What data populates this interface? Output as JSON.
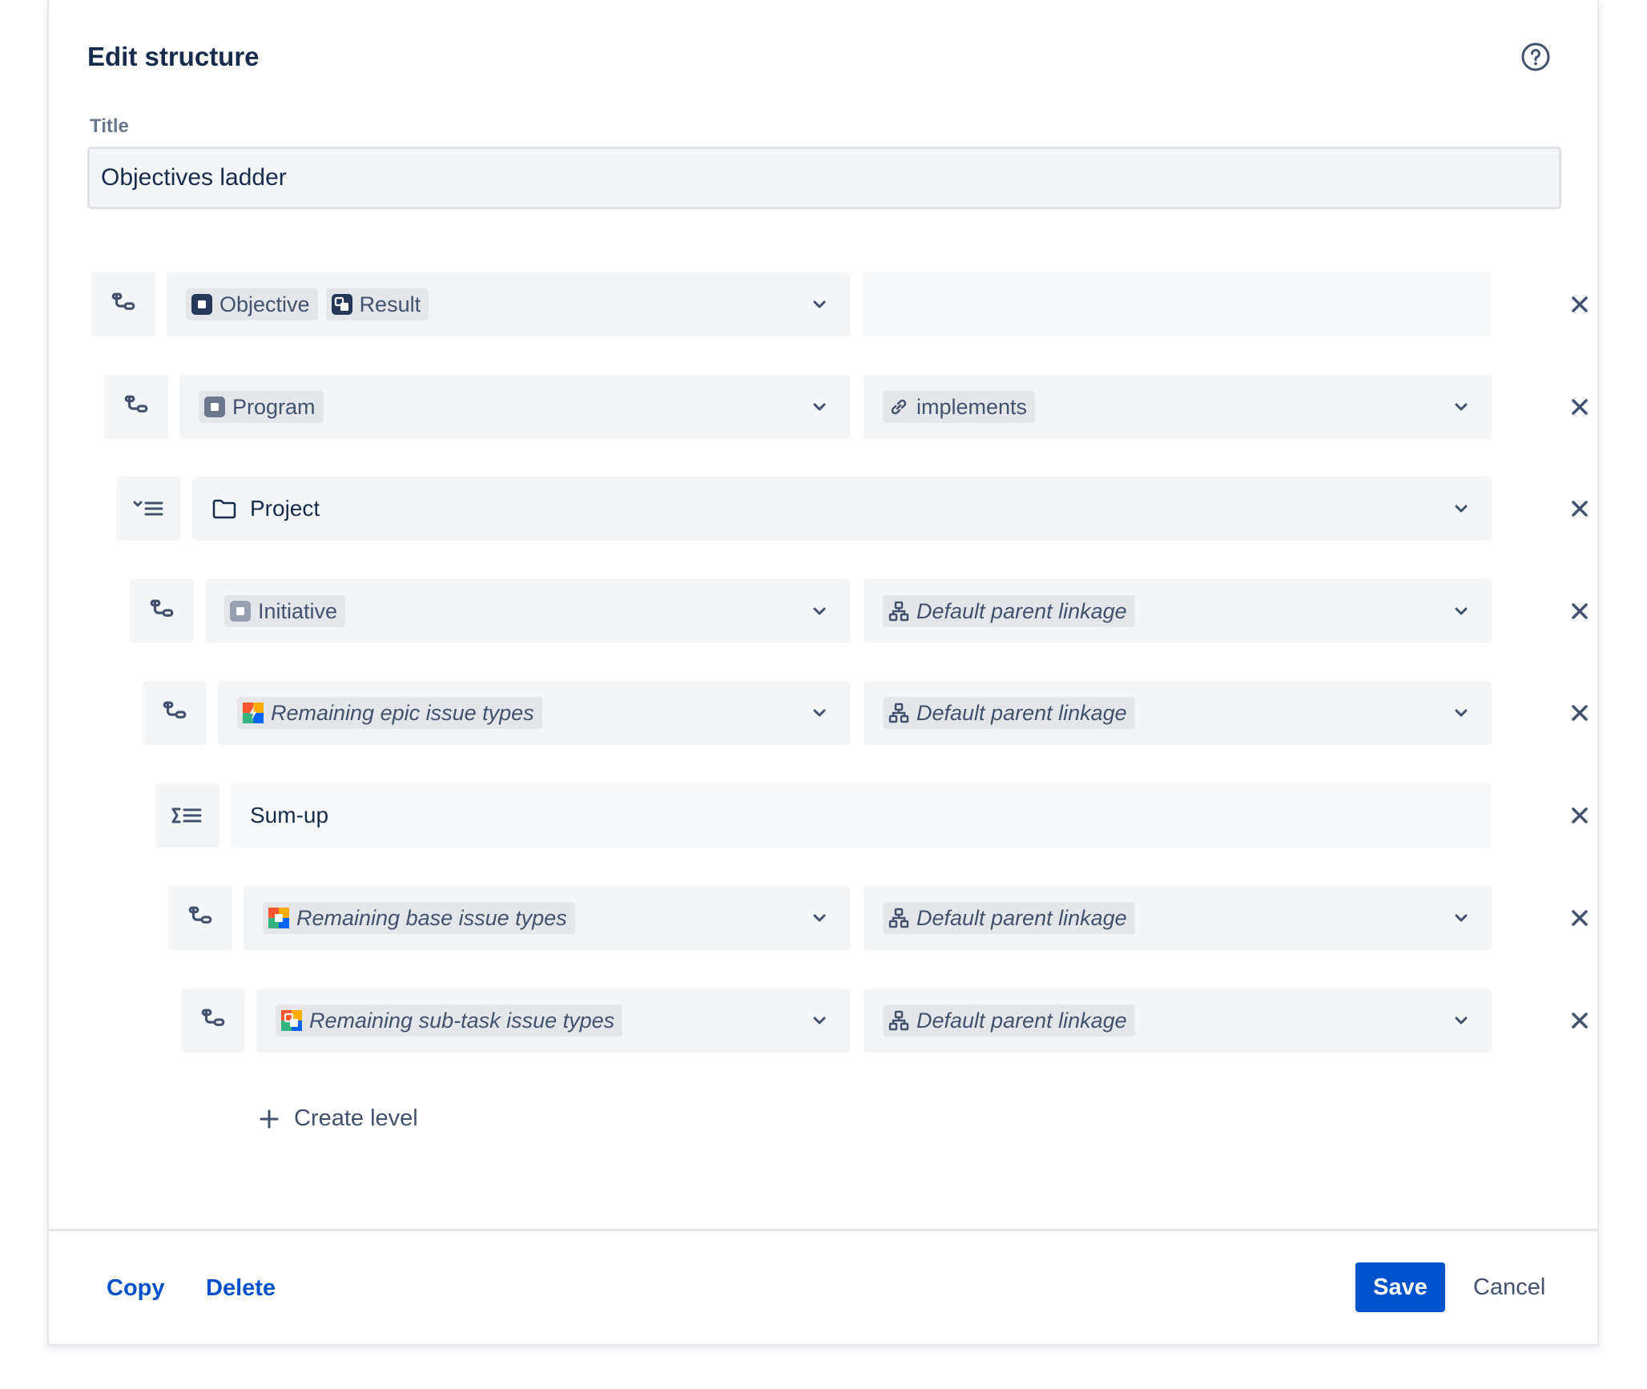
{
  "dialog": {
    "title": "Edit structure",
    "help_icon": "help-circle-icon"
  },
  "title_field": {
    "label": "Title",
    "value": "Objectives ladder"
  },
  "levels": [
    {
      "handle_icon": "hierarchy-icon",
      "types": [
        {
          "label": "Objective",
          "icon": "objective-type-icon"
        },
        {
          "label": "Result",
          "icon": "result-type-icon"
        }
      ],
      "relation": null
    },
    {
      "handle_icon": "hierarchy-icon",
      "types": [
        {
          "label": "Program",
          "icon": "program-type-icon"
        }
      ],
      "relation": {
        "label": "implements",
        "icon": "link-icon"
      }
    },
    {
      "handle_icon": "grouping-icon",
      "label": "Project",
      "icon": "folder-icon"
    },
    {
      "handle_icon": "hierarchy-icon",
      "types": [
        {
          "label": "Initiative",
          "icon": "initiative-type-icon"
        }
      ],
      "relation": {
        "label": "Default parent linkage",
        "icon": "parent-linkage-icon"
      }
    },
    {
      "handle_icon": "hierarchy-icon",
      "types": [
        {
          "label": "Remaining epic issue types",
          "icon": "epic-types-icon"
        }
      ],
      "relation": {
        "label": "Default parent linkage",
        "icon": "parent-linkage-icon"
      }
    },
    {
      "handle_icon": "sum-icon",
      "label": "Sum-up"
    },
    {
      "handle_icon": "hierarchy-icon",
      "types": [
        {
          "label": "Remaining base issue types",
          "icon": "base-types-icon"
        }
      ],
      "relation": {
        "label": "Default parent linkage",
        "icon": "parent-linkage-icon"
      }
    },
    {
      "handle_icon": "hierarchy-icon",
      "types": [
        {
          "label": "Remaining sub-task issue types",
          "icon": "subtask-types-icon"
        }
      ],
      "relation": {
        "label": "Default parent linkage",
        "icon": "parent-linkage-icon"
      }
    }
  ],
  "create_level": {
    "label": "Create level",
    "icon": "plus-icon"
  },
  "footer": {
    "copy_label": "Copy",
    "delete_label": "Delete",
    "save_label": "Save",
    "cancel_label": "Cancel"
  },
  "colors": {
    "primary": "#0052cc",
    "text": "#172b4d",
    "subtle_text": "#42526e",
    "field_bg": "#f4f5f7",
    "chip_bg": "#e4e6ea"
  }
}
